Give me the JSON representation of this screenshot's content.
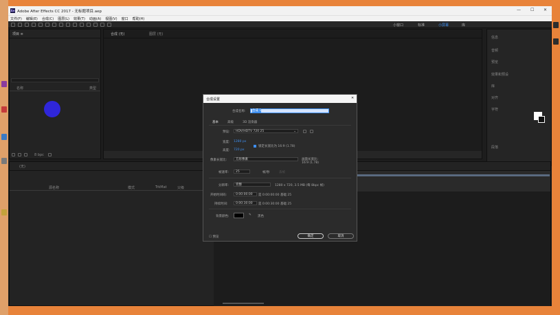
{
  "window": {
    "title": "Adobe After Effects CC 2017 - 无标题项目.aep",
    "logo": "Ae",
    "minimize": "—",
    "maximize": "☐",
    "close": "✕"
  },
  "menu": [
    "文件(F)",
    "编辑(E)",
    "合成(C)",
    "图层(L)",
    "效果(T)",
    "动画(A)",
    "视图(V)",
    "窗口",
    "帮助(H)"
  ],
  "workspaces": {
    "w1": "小窗口",
    "w2": "标准",
    "w3": "小屏幕",
    "w4": "库"
  },
  "project": {
    "tab": "项目 ≡",
    "name_col": "名称",
    "type_col": "类型",
    "bpc": "8 bpc"
  },
  "composition": {
    "tab": "合成 (无)",
    "layer_tab": "图层 (无)"
  },
  "right_panel": {
    "items": [
      "信息",
      "音频",
      "预览",
      "效果和预设",
      "库",
      "对齐",
      "字符",
      "段落"
    ]
  },
  "timeline": {
    "tab": "(无)",
    "source_col": "源名称",
    "mode_col": "模式",
    "trkmat_col": "TrkMat",
    "parent_col": "父级"
  },
  "dialog": {
    "title": "合成设置",
    "close": "✕",
    "name_label": "合成名称:",
    "name_value": "合成 1",
    "tabs": {
      "basic": "基本",
      "advanced": "高级",
      "renderer": "3D 渲染器"
    },
    "preset_label": "预设:",
    "preset_value": "HDV/HDTV 720 25",
    "width_label": "宽度:",
    "width_value": "1280 px",
    "height_label": "高度:",
    "height_value": "720 px",
    "lock_label": "锁定长宽比为 16:9 (1.78)",
    "pixel_aspect_label": "像素长宽比:",
    "pixel_aspect_value": "方形像素",
    "frame_aspect_label": "画面长宽比:",
    "frame_aspect_value": "16:9 (1.78)",
    "fps_label": "帧速率:",
    "fps_value": "25",
    "fps_unit": "帧/秒",
    "fps_drop": "丢帧",
    "resolution_label": "分辨率:",
    "resolution_value": "完整",
    "resolution_info": "1280 x 720, 3.5 MB (每 8bpc 帧)",
    "start_label": "开始时间码:",
    "start_value": "0:00:00:00",
    "start_info": "是 0:00:00:00 基础 25",
    "duration_label": "持续时间:",
    "duration_value": "0:00:30:00",
    "duration_info": "是 0:00:30:00 基础 25",
    "bg_label": "背景颜色:",
    "bg_color_name": "黑色",
    "preview_label": "预览",
    "ok": "确定",
    "cancel": "取消"
  },
  "colors": {
    "accent": "#3d8ef0",
    "cursor": "#2f26d9",
    "desktop": "#e8833a"
  }
}
